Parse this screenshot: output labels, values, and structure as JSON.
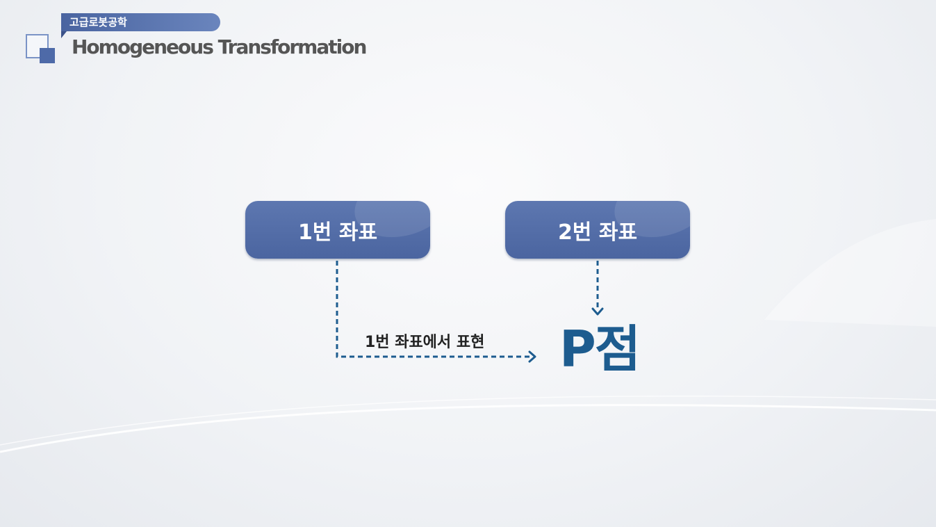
{
  "header": {
    "course_label": "고급로봇공학",
    "title": "Homogeneous Transformation"
  },
  "diagram": {
    "frame1_label": "1번 좌표",
    "frame2_label": "2번 좌표",
    "expression_label": "1번 좌표에서 표현",
    "point_label": "P점"
  },
  "colors": {
    "box_fill": "#5470aa",
    "arrow": "#1d5c8f",
    "point_text": "#1d5c8f",
    "badge": "#5a75b0"
  }
}
